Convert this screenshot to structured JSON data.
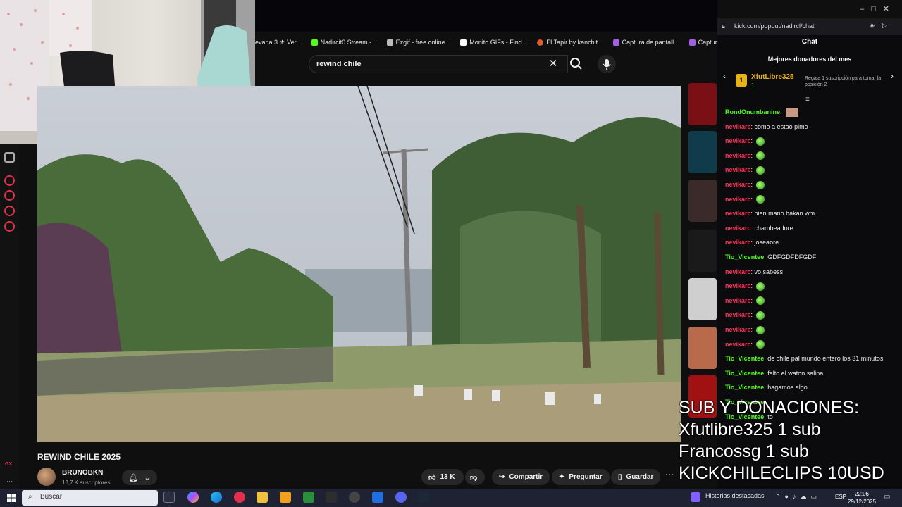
{
  "browser": {
    "bookmarks": [
      {
        "label": "evana 3 ⚜ Ver...",
        "color": "#d7b04a"
      },
      {
        "label": "Nadircit0 Stream -...",
        "color": "#53fc18"
      },
      {
        "label": "Ezgif - free online...",
        "color": "#bbbbbb"
      },
      {
        "label": "Monito GIFs - Find...",
        "color": "#ffffff"
      },
      {
        "label": "El Tapir by kanchit...",
        "color": "#e05a2a"
      },
      {
        "label": "Captura de pantall...",
        "color": "#a060e0"
      },
      {
        "label": "Captura de p",
        "color": "#a060e0"
      }
    ]
  },
  "youtube": {
    "search_query": "rewind chile",
    "video_title": "REWIND CHILE 2025",
    "channel_name": "BRUNOBKN",
    "subscribers": "13,7 K suscriptores",
    "likes": "13 K",
    "share_label": "Compartir",
    "ask_label": "Preguntar",
    "save_label": "Guardar"
  },
  "chat": {
    "url": "kick.com/popout/nadircl/chat",
    "header": "Chat",
    "donors_title": "Mejores donadores del mes",
    "top_donor": {
      "rank": "1",
      "name": "XfutLibre325",
      "count": "1"
    },
    "gift_hint": "Regala 1 suscripción para tomar la posición 2",
    "messages": [
      {
        "user": "RondOnumbanine",
        "color": "green",
        "text": "",
        "emotes": 0,
        "image": true
      },
      {
        "user": "nevikarc",
        "color": "red",
        "text": "como a estao pimo",
        "emotes": 0
      },
      {
        "user": "nevikarc",
        "color": "red",
        "text": "",
        "emotes": 1
      },
      {
        "user": "nevikarc",
        "color": "red",
        "text": "",
        "emotes": 1
      },
      {
        "user": "nevikarc",
        "color": "red",
        "text": "",
        "emotes": 1
      },
      {
        "user": "nevikarc",
        "color": "red",
        "text": "",
        "emotes": 1
      },
      {
        "user": "nevikarc",
        "color": "red",
        "text": "",
        "emotes": 1
      },
      {
        "user": "nevikarc",
        "color": "red",
        "text": "bien mano bakan wm",
        "emotes": 0
      },
      {
        "user": "nevikarc",
        "color": "red",
        "text": "chambeadore",
        "emotes": 0
      },
      {
        "user": "nevikarc",
        "color": "red",
        "text": "joseaore",
        "emotes": 0
      },
      {
        "user": "Tio_Vicentee",
        "color": "green",
        "text": "GDFGDFDFGDF",
        "emotes": 0
      },
      {
        "user": "nevikarc",
        "color": "red",
        "text": "vo sabess",
        "emotes": 0
      },
      {
        "user": "nevikarc",
        "color": "red",
        "text": "",
        "emotes": 1
      },
      {
        "user": "nevikarc",
        "color": "red",
        "text": "",
        "emotes": 1
      },
      {
        "user": "nevikarc",
        "color": "red",
        "text": "",
        "emotes": 1
      },
      {
        "user": "nevikarc",
        "color": "red",
        "text": "",
        "emotes": 1
      },
      {
        "user": "nevikarc",
        "color": "red",
        "text": "",
        "emotes": 1
      },
      {
        "user": "Tio_Vicentee",
        "color": "green",
        "text": "de chile pal mundo entero los 31 minutos",
        "emotes": 0
      },
      {
        "user": "Tio_Vicentee",
        "color": "green",
        "text": "falto el waton salina",
        "emotes": 0
      },
      {
        "user": "Tio_Vicentee",
        "color": "green",
        "text": "hagamos algo",
        "emotes": 0
      },
      {
        "user": "Tio_Vicentee",
        "color": "green",
        "text": "",
        "emotes": 0
      },
      {
        "user": "Tio_Vicentee",
        "color": "green",
        "text": "to",
        "emotes": 0
      }
    ]
  },
  "overlay": {
    "line1": "SUB Y DONACIONES:",
    "line2": "Xfutlibre325 1 sub",
    "line3": "Francossg 1 sub",
    "line4": "KICKCHILECLIPS 10USD"
  },
  "taskbar": {
    "search_label": "Buscar",
    "highlights_label": "Historias destacadas",
    "language": "ESP",
    "time": "22:06",
    "date": "29/12/2025"
  },
  "colors": {
    "kick_green": "#53fc18",
    "chat_red": "#ff2d55",
    "gx_red": "#e0304a"
  }
}
